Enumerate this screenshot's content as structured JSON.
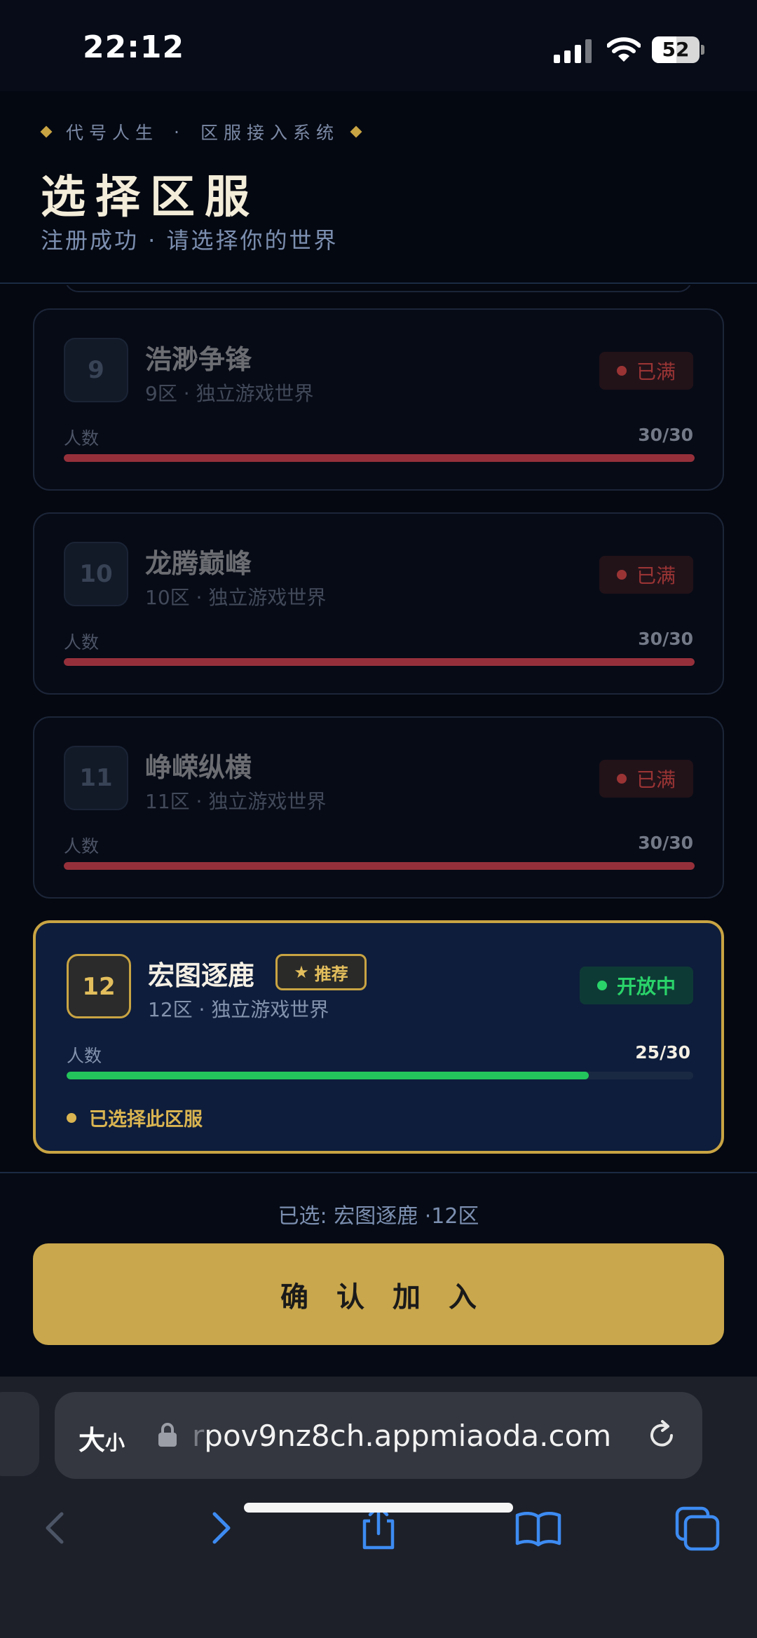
{
  "status_bar": {
    "time": "22:12",
    "battery": "52",
    "battery_level": 0.52
  },
  "header": {
    "eyebrow_left": "代号人生",
    "eyebrow_separator": "·",
    "eyebrow_right": "区服接入系统",
    "title": "选择区服",
    "subtitle": "注册成功 · 请选择你的世界"
  },
  "population_label": "人数",
  "servers": [
    {
      "number": "9",
      "name": "浩渺争锋",
      "subtitle": "9区 · 独立游戏世界",
      "status": "已满",
      "population": "30/30",
      "fill": 1.0
    },
    {
      "number": "10",
      "name": "龙腾巅峰",
      "subtitle": "10区 · 独立游戏世界",
      "status": "已满",
      "population": "30/30",
      "fill": 1.0
    },
    {
      "number": "11",
      "name": "峥嵘纵横",
      "subtitle": "11区 · 独立游戏世界",
      "status": "已满",
      "population": "30/30",
      "fill": 1.0
    },
    {
      "number": "12",
      "name": "宏图逐鹿",
      "subtitle": "12区 · 独立游戏世界",
      "status": "开放中",
      "population": "25/30",
      "fill": 0.8333,
      "tag": "推荐",
      "selected_note": "已选择此区服"
    }
  ],
  "footer": {
    "selected_summary": "已选: 宏图逐鹿 ·12区",
    "confirm_label": "确认加入"
  },
  "browser": {
    "text_size_label": "大",
    "text_size_small": "小",
    "url_prefix": "r",
    "url": "pov9nz8ch.appmiaoda.com"
  },
  "icons": {
    "star": "star-icon",
    "back": "chevron-left-icon",
    "forward": "chevron-right-icon",
    "share": "share-icon",
    "bookmarks": "book-icon",
    "tabs": "tabs-icon",
    "reload": "reload-icon",
    "lock": "lock-icon"
  },
  "colors": {
    "accent_gold": "#c9a443",
    "open_green": "#2ad36a",
    "full_red": "#9a3434",
    "browser_blue": "#3d8bf2"
  }
}
